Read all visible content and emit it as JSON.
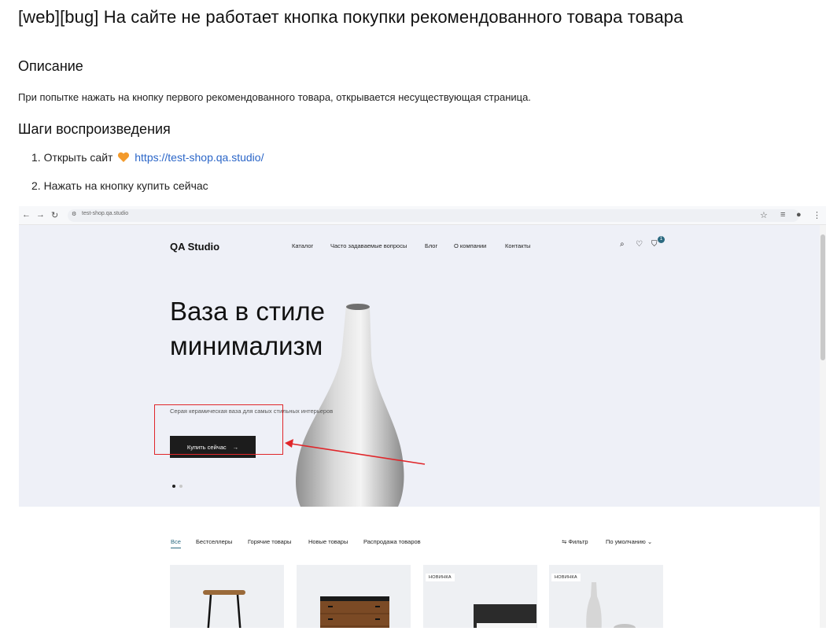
{
  "title": "[web][bug] На сайте не работает кнопка покупки рекомендованного товара товара",
  "description": {
    "heading": "Описание",
    "text": "При попытке нажать на кнопку первого рекомендованного товара, открывается несуществующая страница."
  },
  "steps": {
    "heading": "Шаги воспроизведения",
    "items": [
      {
        "prefix": "1. Открыть сайт",
        "link": "https://test-shop.qa.studio/"
      },
      {
        "prefix": "2. Нажать на кнопку купить сейчас"
      }
    ]
  },
  "screenshot": {
    "browser": {
      "url": "test-shop.qa.studio"
    },
    "site": {
      "logo": "QA Studio",
      "nav": [
        "Каталог",
        "Часто задаваемые вопросы",
        "Блог",
        "О компании",
        "Контакты"
      ],
      "cart_count": "1"
    },
    "hero": {
      "title_line1": "Ваза в стиле",
      "title_line2": "минимализм",
      "subtitle": "Серая керамическая ваза для самых стильных интерьеров",
      "button_label": "Купить сейчас",
      "button_arrow": "→"
    },
    "tabs": [
      "Все",
      "Бестселлеры",
      "Горячие товары",
      "Новые товары",
      "Распродажа товаров"
    ],
    "filter_label": "Фильтр",
    "sort_label": "По умолчанию",
    "badges": {
      "new": "НОВИНКА"
    }
  },
  "colors": {
    "accent_link": "#2b66c8",
    "highlight": "#e0262a",
    "button_bg": "#1c1c1c",
    "hero_bg": "#eef0f7"
  }
}
